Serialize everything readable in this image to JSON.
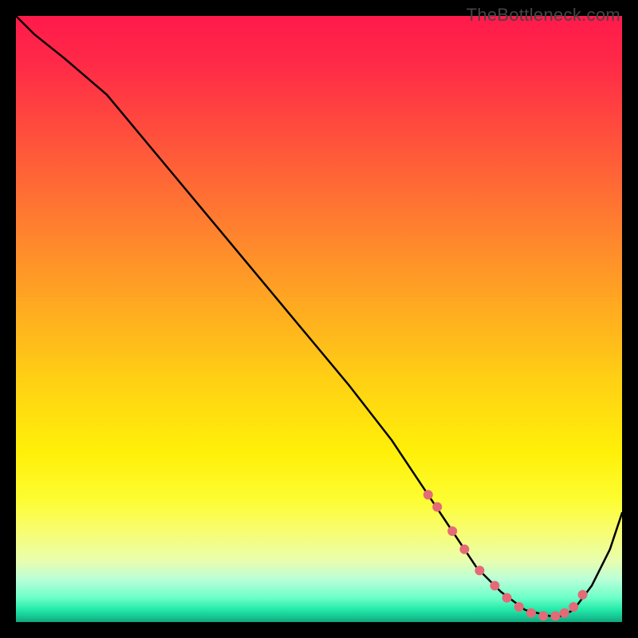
{
  "watermark": "TheBottleneck.com",
  "chart_data": {
    "type": "line",
    "title": "",
    "xlabel": "",
    "ylabel": "",
    "x_range": [
      0,
      100
    ],
    "y_range": [
      100,
      0
    ],
    "grid": false,
    "legend": false,
    "series": [
      {
        "name": "bottleneck-curve",
        "color": "#000000",
        "x": [
          0,
          3,
          8,
          15,
          25,
          35,
          45,
          55,
          62,
          68,
          72,
          76,
          80,
          84,
          88,
          90,
          92,
          95,
          98,
          100
        ],
        "y": [
          100,
          97,
          93,
          87,
          75,
          63,
          51,
          39,
          30,
          21,
          15,
          9,
          5,
          2,
          1,
          1,
          2,
          6,
          12,
          18
        ]
      }
    ],
    "markers": {
      "name": "highlight-dots",
      "color": "#e46a77",
      "radius": 6,
      "x": [
        68,
        69.5,
        72,
        74,
        76.5,
        79,
        81,
        83,
        85,
        87,
        89,
        90.5,
        92,
        93.5
      ],
      "y": [
        21,
        19,
        15,
        12,
        8.5,
        6,
        4,
        2.5,
        1.5,
        1,
        1,
        1.5,
        2.5,
        4.5
      ]
    }
  }
}
